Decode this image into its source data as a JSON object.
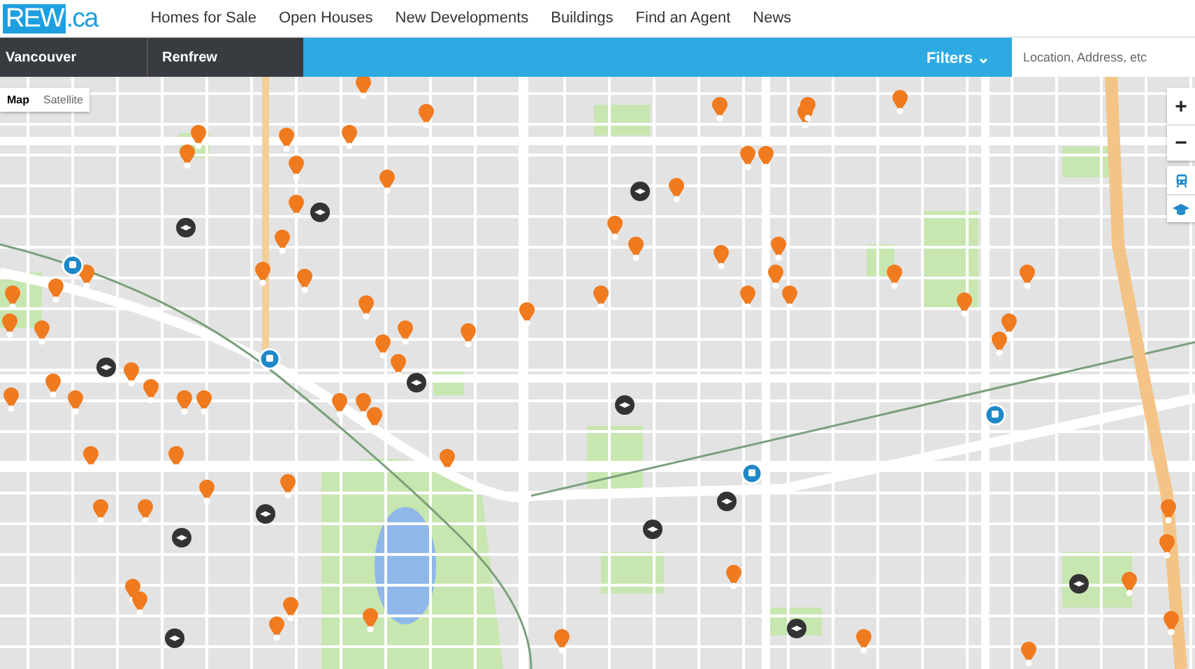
{
  "header": {
    "logo": {
      "part_1": "REW",
      "part_2": ".ca"
    },
    "nav": [
      "Homes for Sale",
      "Open Houses",
      "New Developments",
      "Buildings",
      "Find an Agent",
      "News"
    ]
  },
  "location_bar": {
    "breadcrumbs": [
      "Vancouver",
      "Renfrew"
    ],
    "filters": {
      "label": "Filters",
      "caret": "⌄"
    },
    "search": {
      "placeholder": "Location, Address, etc"
    }
  },
  "map": {
    "type_toggle": [
      {
        "label": "Map",
        "selected": true
      },
      {
        "label": "Satellite",
        "selected": false
      }
    ],
    "zoom": [
      "+",
      "−"
    ],
    "layers": [
      {
        "kind": "transit"
      },
      {
        "kind": "school"
      }
    ]
  }
}
